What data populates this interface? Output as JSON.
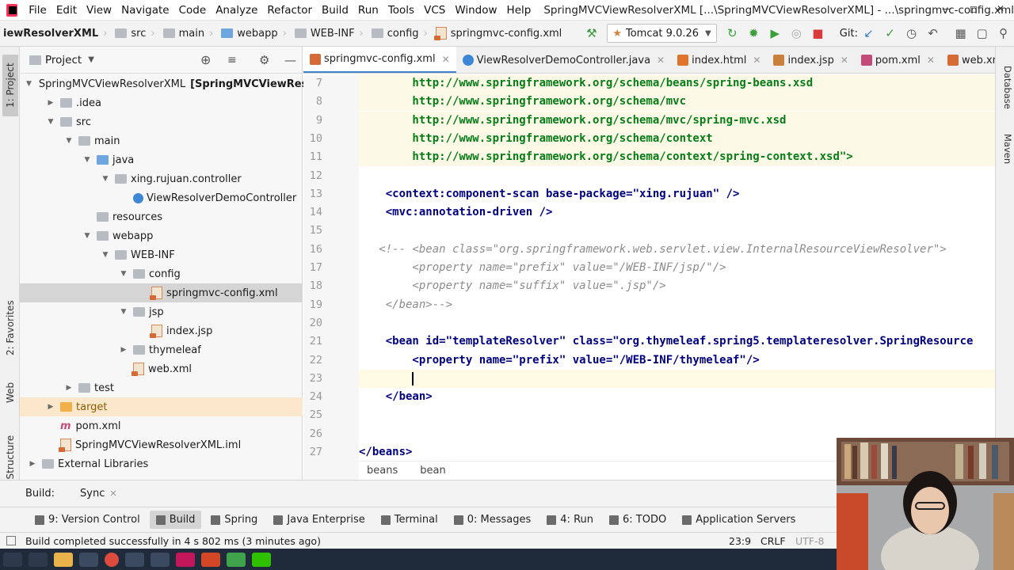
{
  "menu": {
    "items": [
      "File",
      "Edit",
      "View",
      "Navigate",
      "Code",
      "Analyze",
      "Refactor",
      "Build",
      "Run",
      "Tools",
      "VCS",
      "Window",
      "Help"
    ],
    "window_title": "SpringMVCViewResolverXML [...\\SpringMVCViewResolverXML] - ...\\springmvc-config.xml"
  },
  "navbar": {
    "breadcrumbs": [
      "iewResolverXML",
      "src",
      "main",
      "webapp",
      "WEB-INF",
      "config",
      "springmvc-config.xml"
    ],
    "run_config": "Tomcat 9.0.26",
    "git_label": "Git:"
  },
  "left_strip": {
    "project": "1: Project",
    "favorites": "2: Favorites",
    "web": "Web",
    "structure": "7: Structure"
  },
  "right_strip": {
    "database": "Database",
    "maven": "Maven"
  },
  "project_panel": {
    "title": "Project",
    "tree": [
      {
        "label": "SpringMVCViewResolverXML",
        "suffix": "[SpringMVCViewReso",
        "depth": 0,
        "arrow": "down",
        "icon": "module"
      },
      {
        "label": ".idea",
        "depth": 1,
        "arrow": "right",
        "icon": "folder"
      },
      {
        "label": "src",
        "depth": 1,
        "arrow": "down",
        "icon": "folder"
      },
      {
        "label": "main",
        "depth": 2,
        "arrow": "down",
        "icon": "folder"
      },
      {
        "label": "java",
        "depth": 3,
        "arrow": "down",
        "icon": "folder-blue"
      },
      {
        "label": "xing.rujuan.controller",
        "depth": 4,
        "arrow": "down",
        "icon": "package"
      },
      {
        "label": "ViewResolverDemoController",
        "depth": 5,
        "arrow": "",
        "icon": "class"
      },
      {
        "label": "resources",
        "depth": 3,
        "arrow": "",
        "icon": "folder"
      },
      {
        "label": "webapp",
        "depth": 3,
        "arrow": "down",
        "icon": "folder"
      },
      {
        "label": "WEB-INF",
        "depth": 4,
        "arrow": "down",
        "icon": "folder"
      },
      {
        "label": "config",
        "depth": 5,
        "arrow": "down",
        "icon": "folder"
      },
      {
        "label": "springmvc-config.xml",
        "depth": 6,
        "arrow": "",
        "icon": "xml",
        "selected": true
      },
      {
        "label": "jsp",
        "depth": 5,
        "arrow": "down",
        "icon": "folder"
      },
      {
        "label": "index.jsp",
        "depth": 6,
        "arrow": "",
        "icon": "jsp"
      },
      {
        "label": "thymeleaf",
        "depth": 5,
        "arrow": "right",
        "icon": "folder"
      },
      {
        "label": "web.xml",
        "depth": 5,
        "arrow": "",
        "icon": "xml"
      },
      {
        "label": "test",
        "depth": 2,
        "arrow": "right",
        "icon": "folder"
      },
      {
        "label": "target",
        "depth": 1,
        "arrow": "right",
        "icon": "folder-orange",
        "highlight": true
      },
      {
        "label": "pom.xml",
        "depth": 1,
        "arrow": "",
        "icon": "maven"
      },
      {
        "label": "SpringMVCViewResolverXML.iml",
        "depth": 1,
        "arrow": "",
        "icon": "iml"
      },
      {
        "label": "External Libraries",
        "depth": 0,
        "arrow": "right",
        "icon": "library"
      }
    ]
  },
  "tabs": [
    {
      "label": "springmvc-config.xml",
      "active": true,
      "icon": "xml"
    },
    {
      "label": "ViewResolverDemoController.java",
      "icon": "class"
    },
    {
      "label": "index.html",
      "icon": "html"
    },
    {
      "label": "index.jsp",
      "icon": "jsp"
    },
    {
      "label": "pom.xml",
      "icon": "maven"
    },
    {
      "label": "web.xml",
      "icon": "xml"
    }
  ],
  "code": {
    "lines": [
      {
        "n": "7",
        "t": "        http://www.springframework.org/schema/beans/spring-beans.xsd",
        "k": "str",
        "hl": true
      },
      {
        "n": "8",
        "t": "        http://www.springframework.org/schema/mvc",
        "k": "str",
        "hl": true
      },
      {
        "n": "9",
        "t": "        http://www.springframework.org/schema/mvc/spring-mvc.xsd",
        "k": "str",
        "hl": true
      },
      {
        "n": "10",
        "t": "        http://www.springframework.org/schema/context",
        "k": "str",
        "hl": true
      },
      {
        "n": "11",
        "t": "        http://www.springframework.org/schema/context/spring-context.xsd\">",
        "k": "str",
        "hl": true
      },
      {
        "n": "12",
        "t": "",
        "k": ""
      },
      {
        "n": "13",
        "t": "    <context:component-scan base-package=\"xing.rujuan\" />",
        "k": "tag"
      },
      {
        "n": "14",
        "t": "    <mvc:annotation-driven />",
        "k": "tag"
      },
      {
        "n": "15",
        "t": "",
        "k": ""
      },
      {
        "n": "16",
        "t": "   <!-- <bean class=\"org.springframework.web.servlet.view.InternalResourceViewResolver\">",
        "k": "cmt"
      },
      {
        "n": "17",
        "t": "        <property name=\"prefix\" value=\"/WEB-INF/jsp/\"/>",
        "k": "cmt"
      },
      {
        "n": "18",
        "t": "        <property name=\"suffix\" value=\".jsp\"/>",
        "k": "cmt"
      },
      {
        "n": "19",
        "t": "    </bean>-->",
        "k": "cmt"
      },
      {
        "n": "20",
        "t": "",
        "k": ""
      },
      {
        "n": "21",
        "t": "    <bean id=\"templateResolver\" class=\"org.thymeleaf.spring5.templateresolver.SpringResource",
        "k": "tag"
      },
      {
        "n": "22",
        "t": "        <property name=\"prefix\" value=\"/WEB-INF/thymeleaf\"/>",
        "k": "tag"
      },
      {
        "n": "23",
        "t": "        ",
        "k": "",
        "cur": true
      },
      {
        "n": "24",
        "t": "    </bean>",
        "k": "tag"
      },
      {
        "n": "25",
        "t": "",
        "k": ""
      },
      {
        "n": "26",
        "t": "",
        "k": ""
      },
      {
        "n": "27",
        "t": "</beans>",
        "k": "tag"
      }
    ]
  },
  "editor_breadcrumb": [
    "beans",
    "bean"
  ],
  "build_bar": {
    "label": "Build:",
    "tab": "Sync"
  },
  "tool_windows": [
    {
      "label": "9: Version Control"
    },
    {
      "label": "Build",
      "active": true
    },
    {
      "label": "Spring"
    },
    {
      "label": "Java Enterprise"
    },
    {
      "label": "Terminal"
    },
    {
      "label": "0: Messages"
    },
    {
      "label": "4: Run"
    },
    {
      "label": "6: TODO"
    },
    {
      "label": "Application Servers"
    }
  ],
  "status": {
    "message": "Build completed successfully in 4 s 802 ms (3 minutes ago)",
    "position": "23:9",
    "line_sep": "CRLF",
    "encoding": "UTF-8"
  },
  "colors": {
    "accent": "#4083c9",
    "string": "#067d17",
    "tag": "#000080",
    "comment": "#8c8c8c"
  }
}
